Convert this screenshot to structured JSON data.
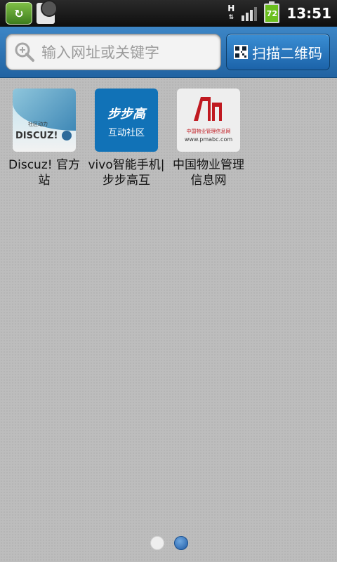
{
  "status_bar": {
    "network_type": "H",
    "battery_level": "72",
    "time": "13:51"
  },
  "search": {
    "placeholder": "输入网址或关键字",
    "scan_button_label": "扫描二维码"
  },
  "tiles": [
    {
      "label": "Discuz! 官方站",
      "thumb_text": "DISCUZ!",
      "thumb_small": "社区动力"
    },
    {
      "label": "vivo智能手机|步步高互",
      "thumb_brand": "步步高",
      "thumb_sub": "互动社区"
    },
    {
      "label": "中国物业管理信息网",
      "thumb_cn": "中国物业管理信息网",
      "thumb_url": "www.pmabc.com"
    }
  ],
  "pager": {
    "pages": 2,
    "active": 2
  },
  "colors": {
    "topbar": "#2f78b8",
    "status_bar": "#111111",
    "content_bg": "#bdbdbd",
    "battery": "#6bbf1f"
  }
}
